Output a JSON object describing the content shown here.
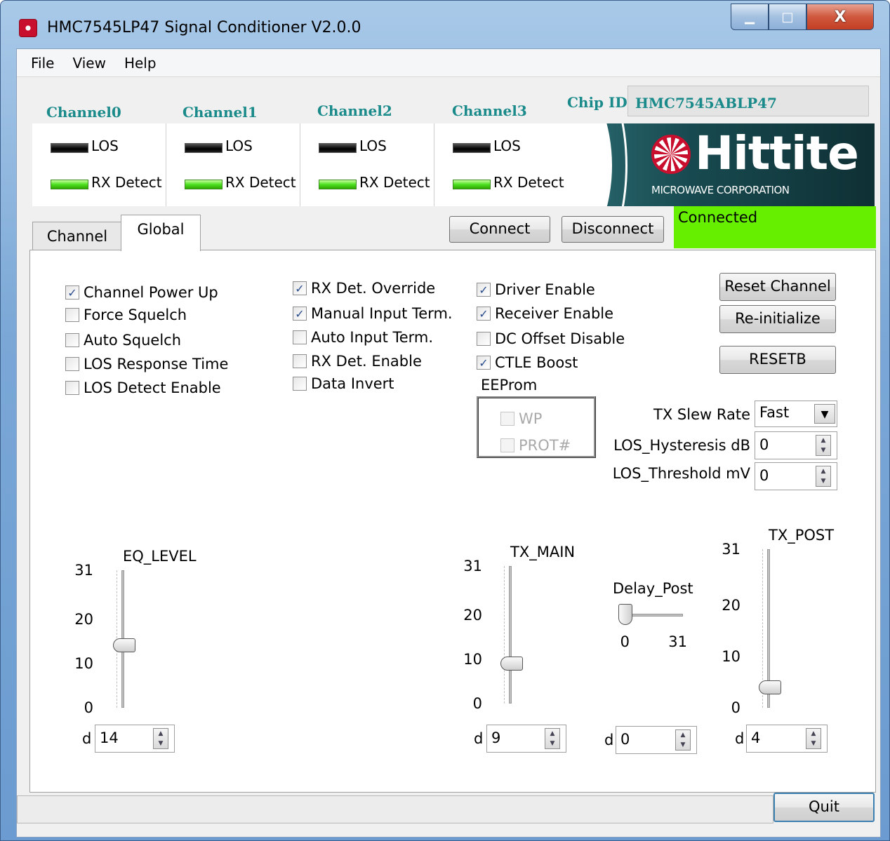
{
  "window": {
    "title": "HMC7545LP47 Signal Conditioner V2.0.0",
    "controls": {
      "minimize": "▁",
      "maximize": "□",
      "close": "X"
    }
  },
  "menu": [
    "File",
    "View",
    "Help"
  ],
  "channels": [
    {
      "label": "Channel0",
      "los": "LOS",
      "rx": "RX Detect"
    },
    {
      "label": "Channel1",
      "los": "LOS",
      "rx": "RX Detect"
    },
    {
      "label": "Channel2",
      "los": "LOS",
      "rx": "RX Detect"
    },
    {
      "label": "Channel3",
      "los": "LOS",
      "rx": "RX Detect"
    }
  ],
  "chip": {
    "label": "Chip ID",
    "value": "HMC7545ABLP47"
  },
  "logo": {
    "text": "Hittite",
    "subtitle": "MICROWAVE CORPORATION"
  },
  "tabs": {
    "channel": "Channel",
    "global": "Global"
  },
  "connection": {
    "connect": "Connect",
    "disconnect": "Disconnect",
    "status": "Connected",
    "status_color": "#66f000"
  },
  "checkboxes": {
    "col1": [
      {
        "label": "Channel Power Up",
        "checked": "✓"
      },
      {
        "label": "Force Squelch",
        "checked": ""
      },
      {
        "label": "Auto Squelch",
        "checked": ""
      },
      {
        "label": "LOS Response Time",
        "checked": ""
      },
      {
        "label": "LOS Detect Enable",
        "checked": ""
      }
    ],
    "col2": [
      {
        "label": "RX Det. Override",
        "checked": "✓"
      },
      {
        "label": "Manual Input Term.",
        "checked": "✓"
      },
      {
        "label": "Auto Input Term.",
        "checked": ""
      },
      {
        "label": "RX Det. Enable",
        "checked": ""
      },
      {
        "label": "Data Invert",
        "checked": ""
      }
    ],
    "col3": [
      {
        "label": "Driver Enable",
        "checked": "✓"
      },
      {
        "label": "Receiver Enable",
        "checked": "✓"
      },
      {
        "label": "DC Offset Disable",
        "checked": ""
      },
      {
        "label": "CTLE Boost",
        "checked": "✓"
      }
    ]
  },
  "eeprom": {
    "label": "EEProm",
    "wp": "WP",
    "prot": "PROT#"
  },
  "buttons": {
    "reset_channel": "Reset Channel",
    "reinitialize": "Re-initialize",
    "resetb": "RESETB",
    "quit": "Quit"
  },
  "fields": {
    "tx_slew": {
      "label": "TX Slew Rate",
      "value": "Fast"
    },
    "los_hyst": {
      "label": "LOS_Hysteresis dB",
      "value": "0"
    },
    "los_thresh": {
      "label": "LOS_Threshold mV",
      "value": "0"
    }
  },
  "sliders": {
    "eq_level": {
      "label": "EQ_LEVEL",
      "min": 0,
      "max": 31,
      "value": 14,
      "display": "14",
      "ticks": [
        "31",
        "20",
        "10",
        "0"
      ]
    },
    "tx_main": {
      "label": "TX_MAIN",
      "min": 0,
      "max": 31,
      "value": 9,
      "display": "9",
      "ticks": [
        "31",
        "20",
        "10",
        "0"
      ]
    },
    "delay_post": {
      "label": "Delay_Post",
      "min": 0,
      "max": 31,
      "value": 0,
      "display": "0",
      "ticks": [
        "0",
        "31"
      ]
    },
    "tx_post": {
      "label": "TX_POST",
      "min": 0,
      "max": 31,
      "value": 4,
      "display": "4",
      "ticks": [
        "31",
        "20",
        "10",
        "0"
      ]
    }
  },
  "radix": "d",
  "icons": {
    "spin_up": "▲",
    "spin_down": "▼",
    "dropdown": "▼"
  }
}
